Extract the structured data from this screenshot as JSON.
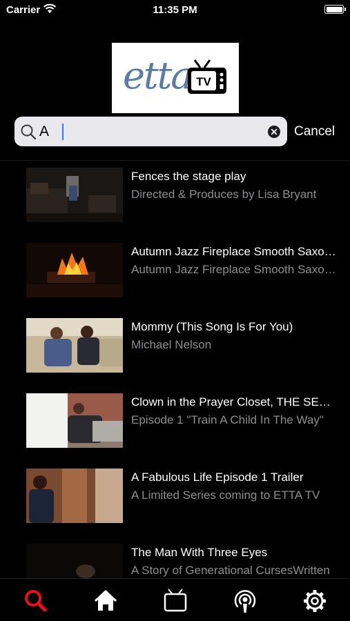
{
  "status": {
    "carrier": "Carrier",
    "time": "11:35 PM"
  },
  "logo": {
    "text": "etta",
    "tv": "TV"
  },
  "search": {
    "value": "A",
    "cancel_label": "Cancel"
  },
  "results": [
    {
      "title": "Fences the stage play",
      "subtitle": "Directed & Produces by Lisa Bryant"
    },
    {
      "title": "Autumn Jazz Fireplace Smooth Saxophone",
      "subtitle": "Autumn Jazz Fireplace Smooth Saxophone"
    },
    {
      "title": "Mommy (This Song Is For You)",
      "subtitle": "Michael Nelson"
    },
    {
      "title": "Clown in the Prayer Closet, THE SERIES",
      "subtitle": "Episode 1 \"Train A Child In The Way\""
    },
    {
      "title": "A Fabulous Life Episode 1 Trailer",
      "subtitle": "A Limited Series coming to ETTA TV"
    },
    {
      "title": "The Man With Three Eyes",
      "subtitle": "A Story of Generational CursesWritten"
    }
  ],
  "tabs": [
    {
      "name": "search-icon",
      "active": true
    },
    {
      "name": "home-icon",
      "active": false
    },
    {
      "name": "tv-icon",
      "active": false
    },
    {
      "name": "podcast-icon",
      "active": false
    },
    {
      "name": "gear-icon",
      "active": false
    }
  ],
  "colors": {
    "accent": "#e8101a",
    "background": "#000000",
    "subtitle": "#8e8e93",
    "logo_blue": "#5b7aa6"
  }
}
